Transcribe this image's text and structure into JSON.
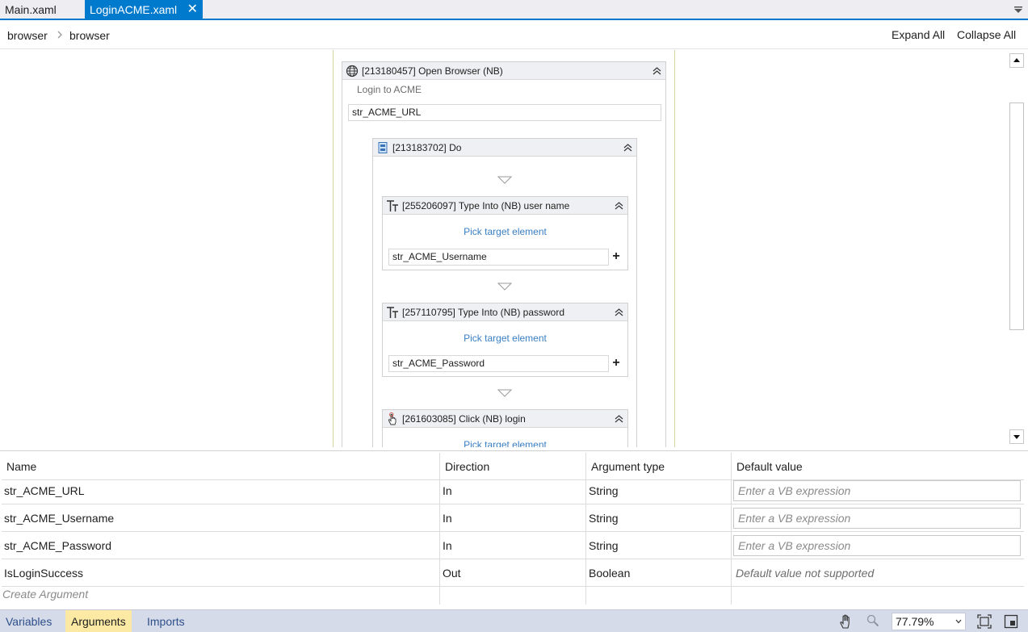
{
  "tabs": [
    {
      "label": "Main.xaml"
    },
    {
      "label": "LoginACME.xaml",
      "close": "✕"
    }
  ],
  "breadcrumb": [
    "browser",
    "browser"
  ],
  "toolbar": {
    "expand_all": "Expand All",
    "collapse_all": "Collapse All"
  },
  "designer": {
    "open_browser": {
      "title": "[213180457] Open Browser (NB)",
      "display_name": "Login to ACME",
      "url_value": "str_ACME_URL"
    },
    "do": {
      "title": "[213183702] Do"
    },
    "type_user": {
      "title": "[255206097] Type Into (NB) user name",
      "pick": "Pick target element",
      "text_value": "str_ACME_Username",
      "plus": "+"
    },
    "type_pass": {
      "title": "[257110795] Type Into (NB) password",
      "pick": "Pick target element",
      "text_value": "str_ACME_Password",
      "plus": "+"
    },
    "click_login": {
      "title": "[261603085] Click (NB) login",
      "pick": "Pick target element"
    }
  },
  "arguments": {
    "columns": [
      "Name",
      "Direction",
      "Argument type",
      "Default value"
    ],
    "rows": [
      {
        "name": "str_ACME_URL",
        "direction": "In",
        "type": "String",
        "default": "Enter a VB expression"
      },
      {
        "name": "str_ACME_Username",
        "direction": "In",
        "type": "String",
        "default": "Enter a VB expression"
      },
      {
        "name": "str_ACME_Password",
        "direction": "In",
        "type": "String",
        "default": "Enter a VB expression"
      },
      {
        "name": "IsLoginSuccess",
        "direction": "Out",
        "type": "Boolean",
        "default": "Default value not supported"
      }
    ],
    "create": "Create Argument"
  },
  "bottom": {
    "tabs": [
      "Variables",
      "Arguments",
      "Imports"
    ],
    "active_tab": "Arguments",
    "zoom": "77.79%"
  },
  "colors": {
    "accent": "#007acc",
    "active_bottom_tab": "#fbe9a4",
    "link": "#3a7fc3"
  }
}
